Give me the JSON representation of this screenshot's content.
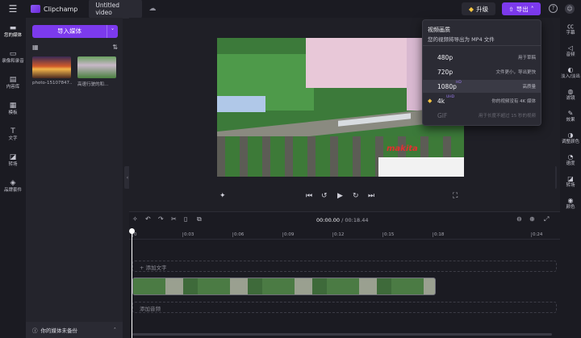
{
  "topbar": {
    "app_name": "Clipchamp",
    "project_title": "Untitled video",
    "upgrade_label": "升级",
    "export_label": "导出",
    "help": "?",
    "avatar": "☺"
  },
  "left_rail": [
    {
      "label": "您的媒体",
      "icon": "folder-icon"
    },
    {
      "label": "录像和录音",
      "icon": "camera-icon"
    },
    {
      "label": "内容库",
      "icon": "library-icon"
    },
    {
      "label": "模板",
      "icon": "template-icon"
    },
    {
      "label": "文字",
      "icon": "text-icon"
    },
    {
      "label": "转场",
      "icon": "transition-icon"
    },
    {
      "label": "品牌套件",
      "icon": "brand-icon"
    }
  ],
  "media_panel": {
    "import_label": "导入媒体",
    "items": [
      {
        "caption": "photo-15107847..."
      },
      {
        "caption": "高速行驶的和..."
      }
    ],
    "backup_text": "你的媒体未备份"
  },
  "right_rail": [
    {
      "label": "字幕",
      "icon": "cc-icon"
    },
    {
      "label": "音频",
      "icon": "audio-icon"
    },
    {
      "label": "淡入/淡出",
      "icon": "fade-icon"
    },
    {
      "label": "滤镜",
      "icon": "filter-icon"
    },
    {
      "label": "效果",
      "icon": "effects-icon"
    },
    {
      "label": "调整颜色",
      "icon": "color-adjust-icon"
    },
    {
      "label": "速度",
      "icon": "speed-icon"
    },
    {
      "label": "转场",
      "icon": "transition-icon"
    },
    {
      "label": "颜色",
      "icon": "palette-icon"
    }
  ],
  "timeline": {
    "current_time": "00:00.00",
    "duration": "/ 00:18.44",
    "ticks": [
      "0",
      "0:03",
      "0:06",
      "0:09",
      "0:12",
      "0:15",
      "0:18",
      "0:24"
    ],
    "text_track_label": "+ 添加文字",
    "audio_track_label": "添加音频"
  },
  "export_menu": {
    "title": "视频画质",
    "subtitle": "您的视频将导出为 MP4 文件",
    "options": [
      {
        "res": "480p",
        "desc": "用于草稿",
        "tag": ""
      },
      {
        "res": "720p",
        "desc": "文件更小，导出更快",
        "tag": ""
      },
      {
        "res": "1080p",
        "desc": "高质量",
        "tag": "HD"
      },
      {
        "res": "4k",
        "desc": "你的视频没有 4K 媒体",
        "tag": "UHD"
      },
      {
        "res": "GIF",
        "desc": "用于长度不超过 15 秒的视频",
        "tag": ""
      }
    ]
  },
  "video_sign": "makita",
  "colors": {
    "accent": "#7c3aed",
    "bg": "#1f1f26",
    "panel": "#24242c"
  }
}
